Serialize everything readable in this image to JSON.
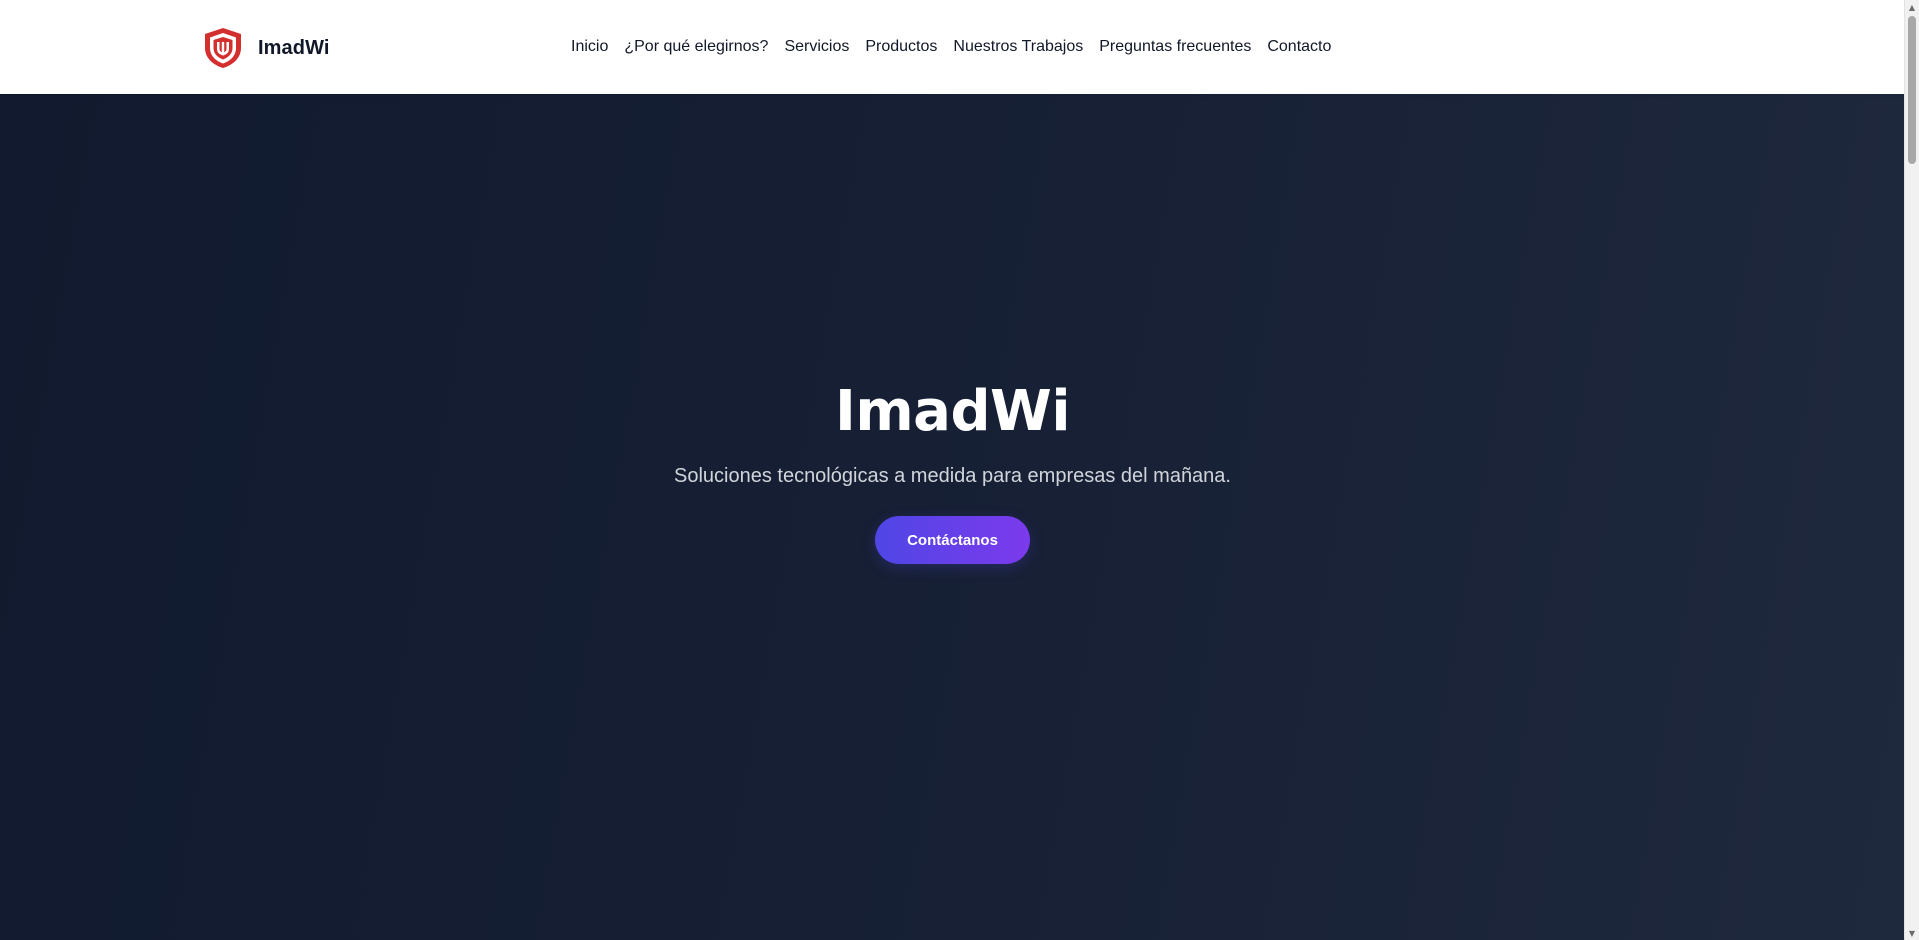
{
  "brand": {
    "name": "ImadWi",
    "logo_icon": "shield-icon",
    "logo_color": "#d32f2f"
  },
  "nav": {
    "items": [
      {
        "label": "Inicio"
      },
      {
        "label": "¿Por qué elegirnos?"
      },
      {
        "label": "Servicios"
      },
      {
        "label": "Productos"
      },
      {
        "label": "Nuestros Trabajos"
      },
      {
        "label": "Preguntas frecuentes"
      },
      {
        "label": "Contacto"
      }
    ]
  },
  "hero": {
    "title": "ImadWi",
    "subtitle": "Soluciones tecnológicas a medida para empresas del mañana.",
    "cta_label": "Contáctanos",
    "accent_start": "#4f46e5",
    "accent_end": "#7c3aed",
    "background": "#111a2e"
  },
  "scrollbar": {
    "up_icon": "scroll-up-arrow-icon",
    "down_icon": "scroll-down-arrow-icon"
  }
}
